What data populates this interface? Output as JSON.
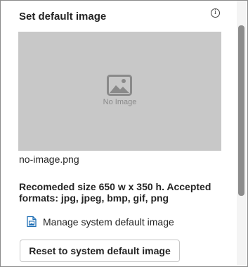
{
  "panel": {
    "title": "Set default image",
    "info_icon": "info-icon",
    "preview": {
      "placeholder_icon": "image-icon",
      "placeholder_text": "No Image"
    },
    "filename": "no-image.png",
    "recommendation": "Recomeded size 650 w x 350 h. Accepted formats: jpg, jpeg, bmp, gif, png",
    "manage_link": {
      "icon": "image-edit-icon",
      "label": "Manage system default image"
    },
    "reset_button": "Reset to system default image"
  },
  "colors": {
    "preview_bg": "#c8c8c8",
    "placeholder": "#8a8a8a",
    "text": "#242424",
    "scroll_thumb": "#8c8c8c"
  }
}
